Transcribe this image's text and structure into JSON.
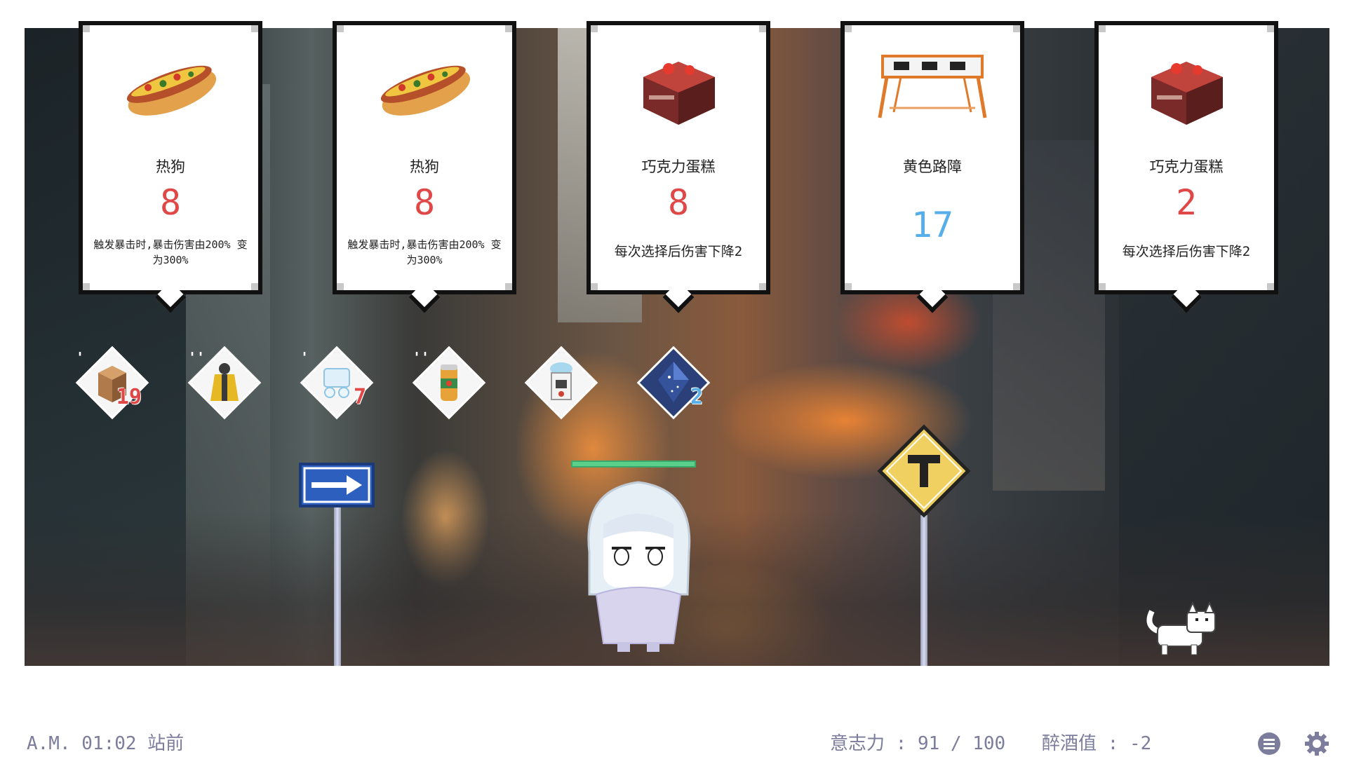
{
  "cards": [
    {
      "name": "热狗",
      "damage": "8",
      "description": "触发暴击时,暴击伤害由200% 变为300%",
      "art": "hotdog-icon"
    },
    {
      "name": "热狗",
      "damage": "8",
      "description": "触发暴击时,暴击伤害由200% 变为300%",
      "art": "hotdog-icon"
    },
    {
      "name": "巧克力蛋糕",
      "damage": "8",
      "description": "每次选择后伤害下降2",
      "art": "chocolate-cake-icon"
    },
    {
      "name": "黄色路障",
      "damage": "17",
      "description": "",
      "art": "roadblock-icon"
    },
    {
      "name": "巧克力蛋糕",
      "damage": "2",
      "description": "每次选择后伤害下降2",
      "art": "chocolate-cake-icon"
    }
  ],
  "inventory": [
    {
      "icon": "cardboard-box-icon",
      "count": "19"
    },
    {
      "icon": "raincoat-person-icon",
      "count": ""
    },
    {
      "icon": "game-controller-icon",
      "count": "7"
    },
    {
      "icon": "soda-can-icon",
      "count": ""
    },
    {
      "icon": "gashapon-machine-icon",
      "count": ""
    },
    {
      "icon": "crystal-icon",
      "count": "2"
    }
  ],
  "inventory_marks": [
    "'",
    "''",
    "'",
    "''"
  ],
  "status": {
    "time_location": "A.M. 01:02 站前",
    "willpower": "意志力 : 91 / 100",
    "drunk": "醉酒值 : -2"
  },
  "player": {
    "hp_fraction": 1.0
  },
  "colors": {
    "damage_red": "#e04848",
    "damage_blue": "#58aee8",
    "hp_green": "#5ad08a",
    "footer_text": "#7c7c9c"
  }
}
